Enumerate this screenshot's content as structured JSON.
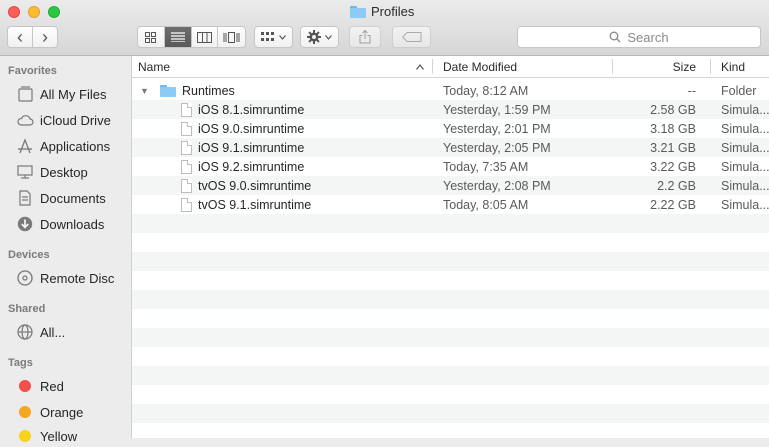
{
  "window": {
    "title": "Profiles"
  },
  "toolbar": {
    "back_icon": "‹",
    "forward_icon": "›",
    "search_placeholder": "Search"
  },
  "sidebar": {
    "favorites_header": "Favorites",
    "favorites": [
      {
        "label": "All My Files",
        "icon": "all-files-icon"
      },
      {
        "label": "iCloud Drive",
        "icon": "cloud-icon"
      },
      {
        "label": "Applications",
        "icon": "applications-icon"
      },
      {
        "label": "Desktop",
        "icon": "desktop-icon"
      },
      {
        "label": "Documents",
        "icon": "documents-icon"
      },
      {
        "label": "Downloads",
        "icon": "downloads-icon"
      }
    ],
    "devices_header": "Devices",
    "devices": [
      {
        "label": "Remote Disc",
        "icon": "disc-icon"
      }
    ],
    "shared_header": "Shared",
    "shared": [
      {
        "label": "All...",
        "icon": "network-icon"
      }
    ],
    "tags_header": "Tags",
    "tags": [
      {
        "label": "Red",
        "color": "#f2504b"
      },
      {
        "label": "Orange",
        "color": "#f5a623"
      },
      {
        "label": "Yellow",
        "color": "#f8d21c"
      }
    ]
  },
  "columns": {
    "name": "Name",
    "date": "Date Modified",
    "size": "Size",
    "kind": "Kind"
  },
  "rows": [
    {
      "name": "Runtimes",
      "date": "Today, 8:12 AM",
      "size": "--",
      "kind": "Folder",
      "type": "folder"
    },
    {
      "name": "iOS 8.1.simruntime",
      "date": "Yesterday, 1:59 PM",
      "size": "2.58 GB",
      "kind": "Simula...",
      "type": "file"
    },
    {
      "name": "iOS 9.0.simruntime",
      "date": "Yesterday, 2:01 PM",
      "size": "3.18 GB",
      "kind": "Simula...",
      "type": "file"
    },
    {
      "name": "iOS 9.1.simruntime",
      "date": "Yesterday, 2:05 PM",
      "size": "3.21 GB",
      "kind": "Simula...",
      "type": "file"
    },
    {
      "name": "iOS 9.2.simruntime",
      "date": "Today, 7:35 AM",
      "size": "3.22 GB",
      "kind": "Simula...",
      "type": "file"
    },
    {
      "name": "tvOS 9.0.simruntime",
      "date": "Yesterday, 2:08 PM",
      "size": "2.2 GB",
      "kind": "Simula...",
      "type": "file"
    },
    {
      "name": "tvOS 9.1.simruntime",
      "date": "Today, 8:05 AM",
      "size": "2.22 GB",
      "kind": "Simula...",
      "type": "file"
    }
  ]
}
